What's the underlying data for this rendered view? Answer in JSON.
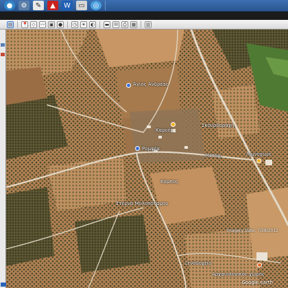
{
  "taskbar": {
    "icons": [
      "globe-icon",
      "settings-icon",
      "pen-tool-icon",
      "pdf-icon",
      "word-icon",
      "printer-icon",
      "browser-icon"
    ]
  },
  "toolbar": {
    "tools": [
      "sidebar-toggle-icon",
      "placemark-icon",
      "polygon-icon",
      "path-icon",
      "overlay-icon",
      "record-tour-icon",
      "historical-imagery-icon",
      "sun-icon",
      "planets-icon",
      "ruler-icon",
      "email-icon",
      "print-icon",
      "save-image-icon",
      "map-view-icon"
    ]
  },
  "map": {
    "labels": [
      "Άγιος Ανδρέας",
      "Καρυές",
      "Σκουρδοράχη",
      "Ρομφέα",
      "Μέτοχι",
      "Λιμνοχώρι",
      "Κάμπος",
      "Στέρνα Μυλοπόταμου",
      "Ξενοδοχείο",
      "Αρχαιολογικός χώρος"
    ],
    "imagery_credit": "Imagery Date: 7/28/2012",
    "footer_credit": "Google earth",
    "colors": {
      "soil": "#b88757",
      "olive": "#4d4a2e",
      "road": "#e4dccd",
      "field": "#5f8f3c"
    }
  }
}
